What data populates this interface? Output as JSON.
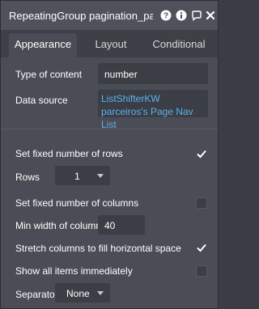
{
  "title": "RepeatingGroup pagination_parceiros",
  "tabs": [
    "Appearance",
    "Layout",
    "Conditional"
  ],
  "fields": {
    "type_of_content": {
      "label": "Type of content",
      "value": "number"
    },
    "data_source": {
      "label": "Data source",
      "value": "ListShifterKW parceiros's Page Nav List"
    },
    "fixed_rows": {
      "label": "Set fixed number of rows",
      "checked": true
    },
    "rows": {
      "label": "Rows",
      "value": "1"
    },
    "fixed_columns": {
      "label": "Set fixed number of columns",
      "checked": false
    },
    "min_width": {
      "label": "Min width of column",
      "value": "40"
    },
    "stretch": {
      "label": "Stretch columns to fill horizontal space",
      "checked": true
    },
    "show_all": {
      "label": "Show all items immediately",
      "checked": false
    },
    "separator": {
      "label": "Separator",
      "value": "None"
    }
  },
  "icons": [
    "help-icon",
    "info-icon",
    "comment-icon",
    "close-icon",
    "checkmark-icon",
    "chevron-down-icon"
  ]
}
